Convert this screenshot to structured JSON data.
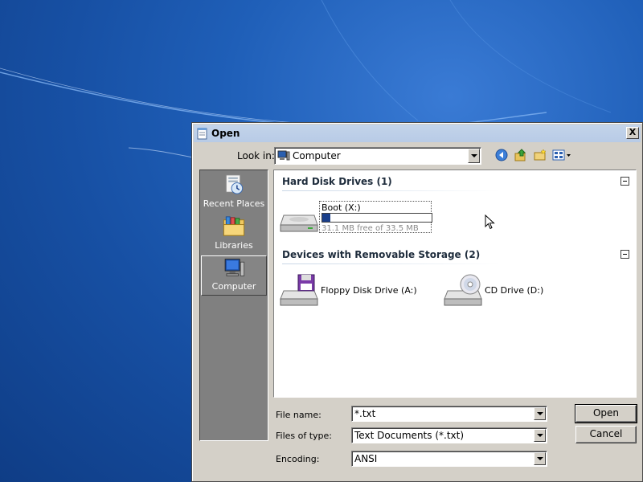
{
  "window": {
    "title": "Open",
    "close_glyph": "X"
  },
  "lookin": {
    "label": "Look in:",
    "value": "Computer",
    "icon": "computer-icon"
  },
  "toolbar": {
    "icons": [
      "back-icon",
      "up-folder-icon",
      "new-folder-icon",
      "view-menu-icon"
    ]
  },
  "places": [
    {
      "label": "Recent Places",
      "icon": "recent-places-icon",
      "selected": false
    },
    {
      "label": "Libraries",
      "icon": "libraries-icon",
      "selected": false
    },
    {
      "label": "Computer",
      "icon": "computer-icon",
      "selected": true
    }
  ],
  "groups": {
    "hard_disk": {
      "header": "Hard Disk Drives (1)",
      "drives": [
        {
          "name": "Boot (X:)",
          "free_text": "31.1 MB free of 33.5 MB",
          "used_fraction": 0.07
        }
      ]
    },
    "removable": {
      "header": "Devices with Removable Storage (2)",
      "drives": [
        {
          "name": "Floppy Disk Drive (A:)",
          "icon": "floppy-drive-icon"
        },
        {
          "name": "CD Drive (D:)",
          "icon": "cd-drive-icon"
        }
      ]
    }
  },
  "fields": {
    "file_name_label": "File name:",
    "file_name_value": "*.txt",
    "file_type_label": "Files of type:",
    "file_type_value": "Text Documents (*.txt)",
    "encoding_label": "Encoding:",
    "encoding_value": "ANSI"
  },
  "buttons": {
    "open": "Open",
    "cancel": "Cancel"
  },
  "colors": {
    "desktop": "#1f5fb8",
    "dialog_face": "#d4d0c8",
    "places_bg": "#808080",
    "usage_bar": "#1a3f8a"
  }
}
